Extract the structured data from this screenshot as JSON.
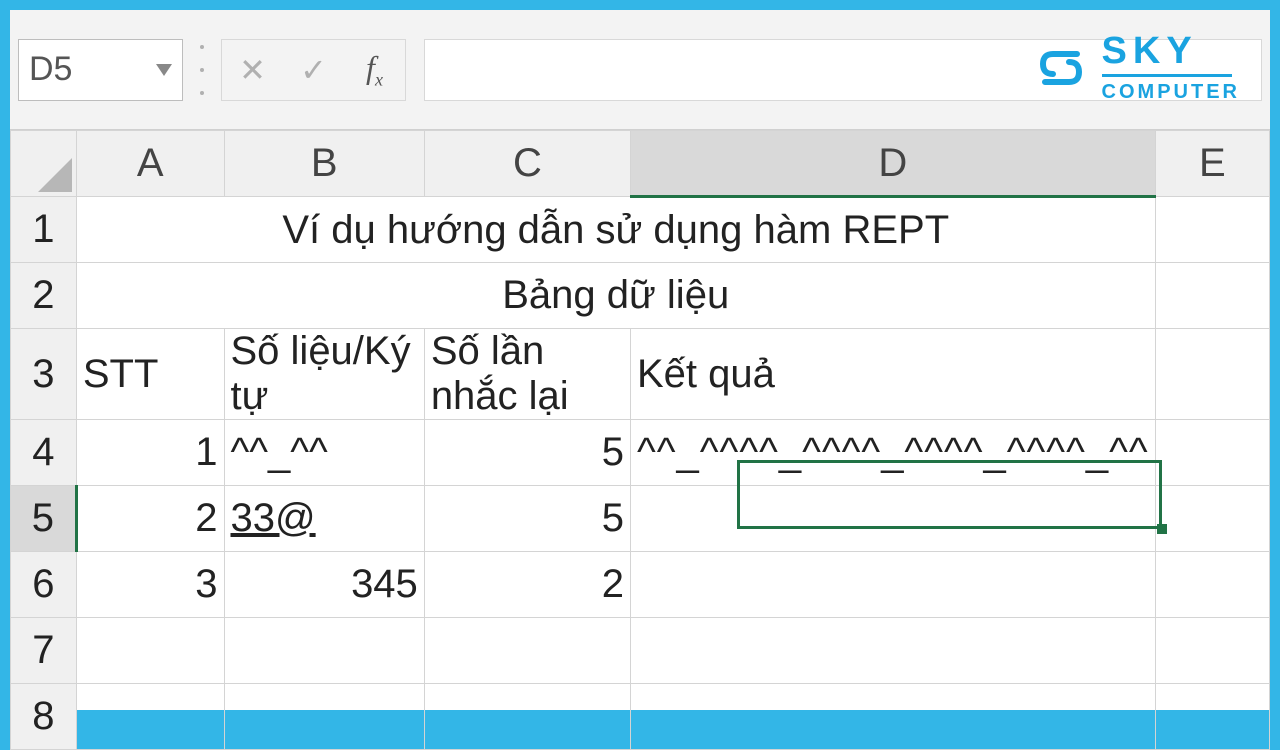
{
  "toolbar": {
    "namebox_value": "D5",
    "cancel_glyph": "✕",
    "enter_glyph": "✓",
    "fx_label": "f",
    "fx_sub": "x",
    "formula_value": ""
  },
  "logo": {
    "brand": "SKY",
    "sub": "COMPUTER"
  },
  "columns": [
    "A",
    "B",
    "C",
    "D",
    "E"
  ],
  "rows": [
    "1",
    "2",
    "3",
    "4",
    "5",
    "6",
    "7",
    "8"
  ],
  "grid": {
    "r1_title": "Ví dụ hướng dẫn sử dụng hàm REPT",
    "r2_title": "Bảng dữ liệu",
    "r3": {
      "A": "STT",
      "B": "Số liệu/Ký tự",
      "C": "Số lần nhắc lại",
      "D": "Kết quả"
    },
    "r4": {
      "A": "1",
      "B": "^^_^^",
      "C": "5",
      "D": "^^_^^^^_^^^^_^^^^_^^^^_^^"
    },
    "r5": {
      "A": "2",
      "B": "33@",
      "C": "5",
      "D": ""
    },
    "r6": {
      "A": "3",
      "B": "345",
      "C": "2",
      "D": ""
    }
  },
  "selection": {
    "cell": "D5"
  }
}
